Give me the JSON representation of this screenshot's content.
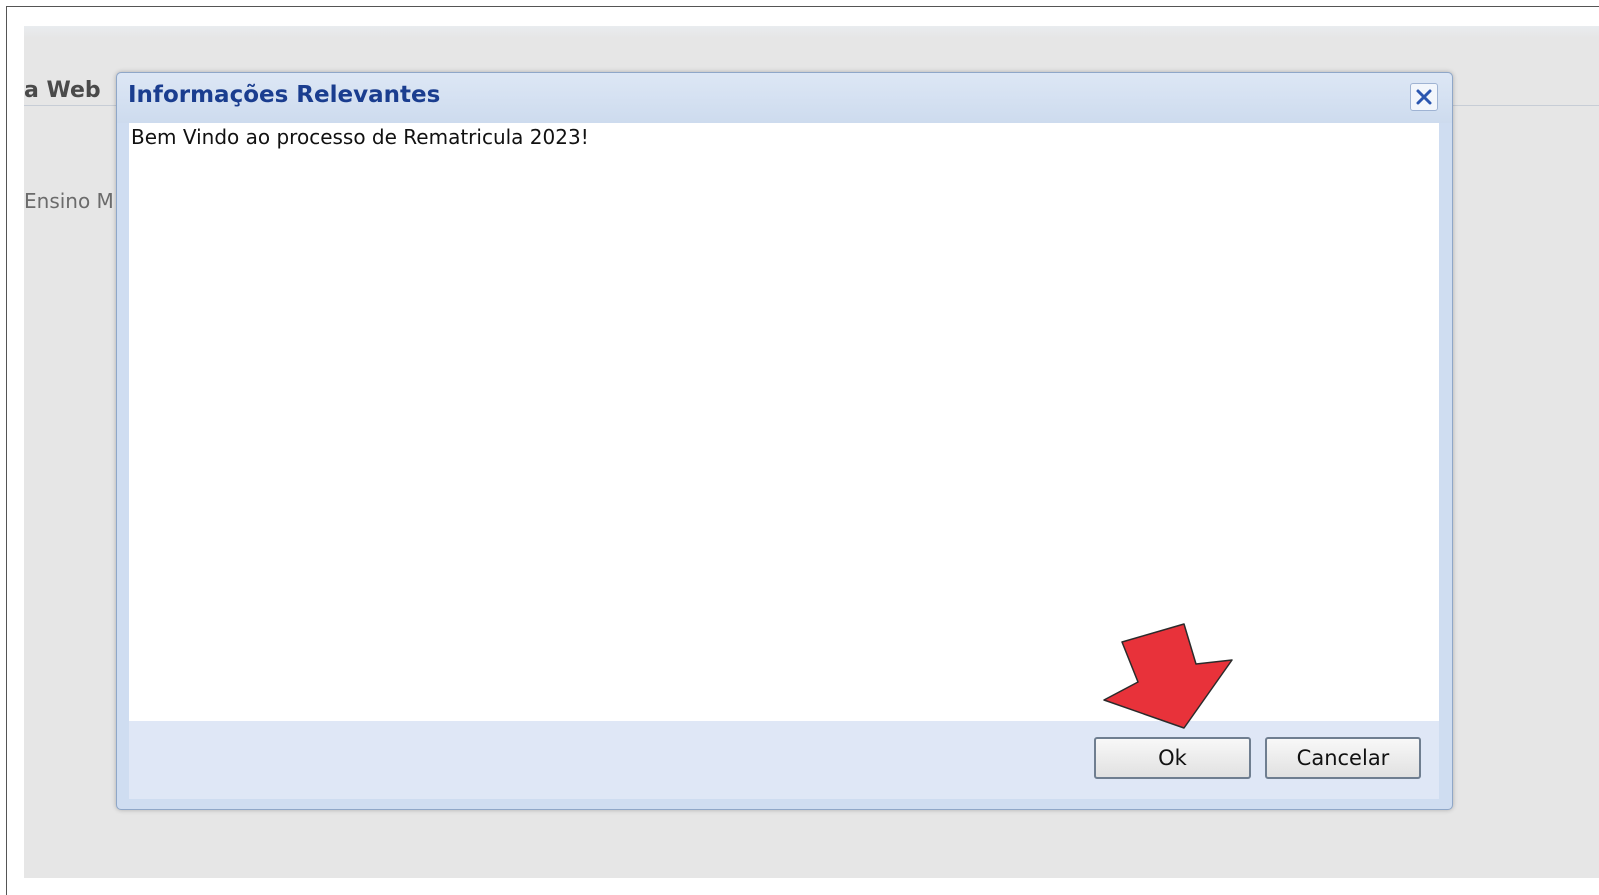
{
  "background_page": {
    "title_fragment": "a Web",
    "subtitle_fragment": "Ensino M"
  },
  "dialog": {
    "title": "Informações Relevantes",
    "close_icon": "close-icon",
    "message": "Bem Vindo ao processo de Rematricula 2023!",
    "ok_label": "Ok",
    "cancel_label": "Cancelar"
  },
  "annotation": {
    "icon": "arrow-pointer-icon",
    "color": "#e8323a"
  },
  "colors": {
    "dialog_title": "#1a3d8f",
    "dialog_frame": "#cfddf1",
    "footer": "#dfe7f6",
    "page_background": "#e6e6e6"
  }
}
